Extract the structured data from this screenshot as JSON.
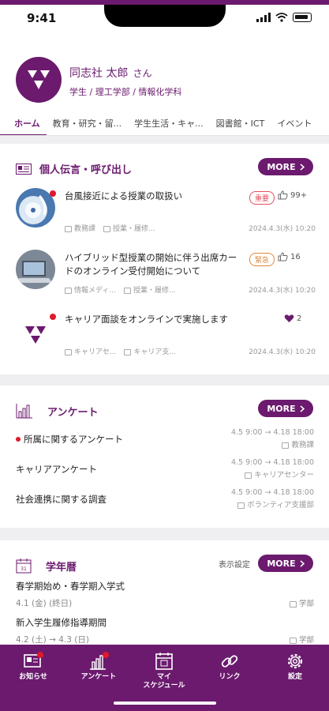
{
  "status_bar": {
    "time": "9:41"
  },
  "profile": {
    "name": "同志社 太郎",
    "honorific": "さん",
    "affiliation": "学生 / 理工学部 / 情報化学科"
  },
  "tabs": [
    "ホーム",
    "教育・研究・留...",
    "学生生活・キャ...",
    "図書館・ICT",
    "イベント"
  ],
  "notices": {
    "title": "個人伝言・呼び出し",
    "more": "MORE",
    "items": [
      {
        "title": "台風接近による授業の取扱い",
        "badge": "重要",
        "likes": "99+",
        "sender": "教務課",
        "category": "授業・履修...",
        "date": "2024.4.3(水) 10:20"
      },
      {
        "title": "ハイブリッド型授業の開始に伴う出席カードのオンライン受付開始について",
        "badge": "緊急",
        "likes": "16",
        "sender": "情報メディ...",
        "category": "授業・履修...",
        "date": "2024.4.3(水) 10:20"
      },
      {
        "title": "キャリア面談をオンラインで実施します",
        "likes": "2",
        "sender": "キャリアセ...",
        "category": "キャリア支...",
        "date": "2024.4.3(水) 10:20"
      }
    ]
  },
  "survey": {
    "title": "アンケート",
    "more": "MORE",
    "items": [
      {
        "title": "所属に関するアンケート",
        "period": "4.5 9:00 → 4.18 18:00",
        "org": "教務課"
      },
      {
        "title": "キャリアアンケート",
        "period": "4.5 9:00 → 4.18 18:00",
        "org": "キャリアセンター"
      },
      {
        "title": "社会連携に関する調査",
        "period": "4.5 9:00 → 4.18 18:00",
        "org": "ボランティア支援部"
      }
    ]
  },
  "calendar": {
    "title": "学年暦",
    "settings": "表示設定",
    "more": "MORE",
    "icon_day": "31",
    "items": [
      {
        "title": "春学期始め・春学期入学式",
        "date": "4.1 (金) (終日)",
        "group": "学部"
      },
      {
        "title": "新入学生履修指導期間",
        "date": "4.2 (土) → 4.3 (日)",
        "group": "学部"
      }
    ]
  },
  "tabbar": {
    "items": [
      {
        "label": "お知らせ"
      },
      {
        "label": "アンケート"
      },
      {
        "label": "マイ\nスケジュール"
      },
      {
        "label": "リンク"
      },
      {
        "label": "設定"
      }
    ]
  },
  "colors": {
    "brand": "#6b1a6e",
    "alert": "#e0192b",
    "important": "#e0505b",
    "urgent": "#e0883b"
  }
}
